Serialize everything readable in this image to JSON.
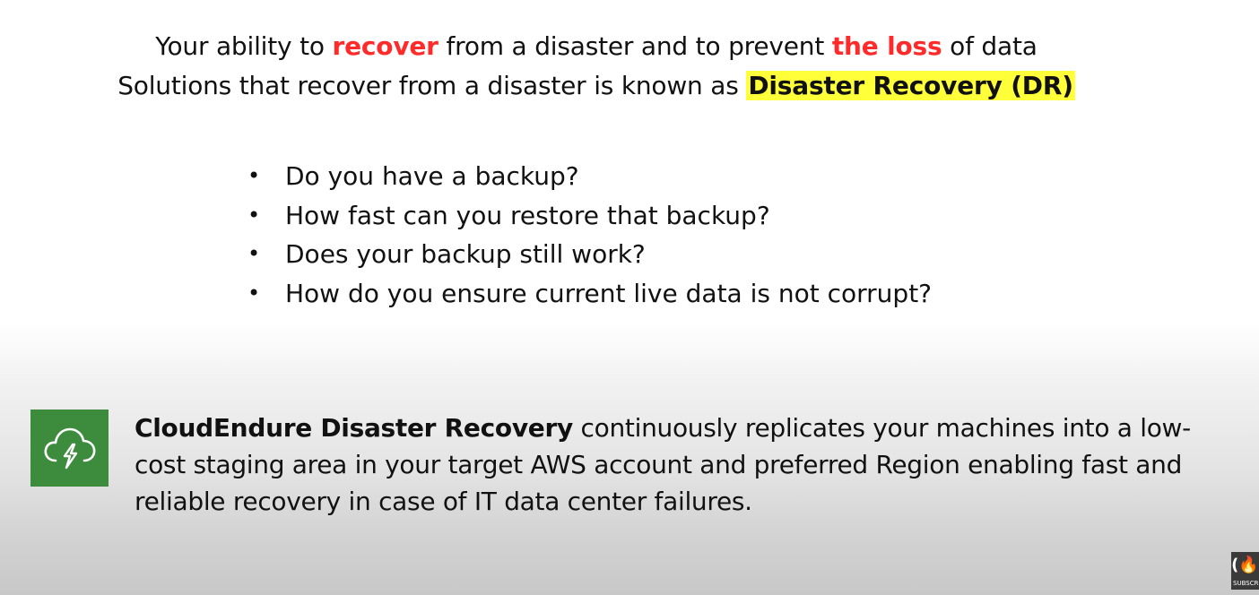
{
  "heading": {
    "line1": {
      "part1": "Your ability to ",
      "emph1": "recover",
      "part2": " from a disaster and to prevent ",
      "emph2": "the loss",
      "part3": " of data"
    },
    "line2": {
      "part1": "Solutions that recover from a disaster is known as ",
      "highlight": "Disaster Recovery (DR)"
    }
  },
  "bullets": [
    "Do you have a backup?",
    "How fast can you restore that backup?",
    "Does your backup still work?",
    "How do you ensure current live data is not corrupt?"
  ],
  "bullet_glyph": "•",
  "service": {
    "icon": "cloud-lightning-icon",
    "name": "CloudEndure Disaster Recovery",
    "description": " continuously replicates your machines into a low-cost staging area in your target AWS account and preferred Region enabling fast and reliable recovery in case of IT data center failures."
  },
  "badge": {
    "icon": "freecodecamp-icon",
    "glyph": "(🔥",
    "label": "SUBSCRIBE"
  },
  "colors": {
    "emphasis_red": "#ff2b2b",
    "highlight_yellow": "#ffff3a",
    "icon_green": "#3d8b3d"
  }
}
